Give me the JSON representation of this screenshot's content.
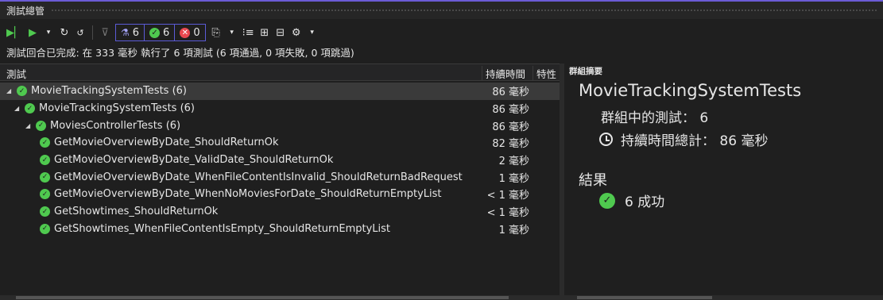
{
  "window": {
    "title": "測試總管"
  },
  "toolbar": {
    "filters": [
      {
        "icon": "flask-icon",
        "count": "6"
      },
      {
        "icon": "passed-icon",
        "count": "6"
      },
      {
        "icon": "failed-icon",
        "count": "0"
      }
    ]
  },
  "status_text": "測試回合已完成: 在 333 毫秒 執行了 6 項測試 (6 項通過, 0 項失敗, 0 項跳過)",
  "columns": {
    "test": "測試",
    "duration": "持續時間",
    "traits": "特性"
  },
  "tree": [
    {
      "name": "MovieTrackingSystemTests (6)",
      "duration": "86 毫秒",
      "level": 0,
      "expanded": true,
      "selected": true
    },
    {
      "name": "MovieTrackingSystemTests (6)",
      "duration": "86 毫秒",
      "level": 1,
      "expanded": true
    },
    {
      "name": "MoviesControllerTests (6)",
      "duration": "86 毫秒",
      "level": 2,
      "expanded": true
    },
    {
      "name": "GetMovieOverviewByDate_ShouldReturnOk",
      "duration": "82 毫秒",
      "level": 3
    },
    {
      "name": "GetMovieOverviewByDate_ValidDate_ShouldReturnOk",
      "duration": "2 毫秒",
      "level": 3
    },
    {
      "name": "GetMovieOverviewByDate_WhenFileContentIsInvalid_ShouldReturnBadRequest",
      "duration": "1 毫秒",
      "level": 3
    },
    {
      "name": "GetMovieOverviewByDate_WhenNoMoviesForDate_ShouldReturnEmptyList",
      "duration": "< 1 毫秒",
      "level": 3
    },
    {
      "name": "GetShowtimes_ShouldReturnOk",
      "duration": "< 1 毫秒",
      "level": 3
    },
    {
      "name": "GetShowtimes_WhenFileContentIsEmpty_ShouldReturnEmptyList",
      "duration": "1 毫秒",
      "level": 3
    }
  ],
  "summary": {
    "title": "群組摘要",
    "group_name": "MovieTrackingSystemTests",
    "tests_in_group": "群組中的測試： 6",
    "total_duration": "持續時間總計： 86 毫秒",
    "result_label": "結果",
    "passed": "6 成功"
  },
  "colors": {
    "accent": "#6b5bd6",
    "passed": "#4fc94f",
    "failed": "#e8484f"
  }
}
